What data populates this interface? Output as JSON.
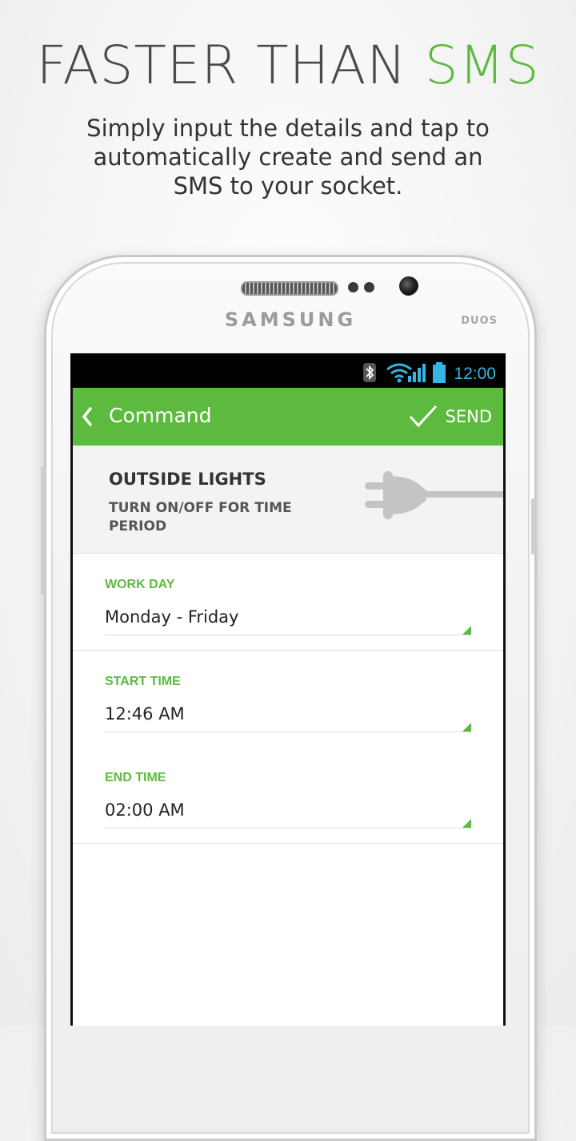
{
  "promo": {
    "headline_main": "FASTER THAN ",
    "headline_accent": "SMS",
    "subtitle": "Simply input the details and tap to automatically create and send an SMS to your socket."
  },
  "phone": {
    "brand": "SAMSUNG",
    "model_badge": "DUOS"
  },
  "status_bar": {
    "time": "12:00",
    "icons": [
      "bluetooth-icon",
      "wifi-icon",
      "signal-icon",
      "battery-icon"
    ]
  },
  "app_bar": {
    "title": "Command",
    "action_label": "SEND",
    "back_icon": "chevron-left-icon",
    "action_icon": "checkmark-icon"
  },
  "device": {
    "name": "OUTSIDE LIGHTS",
    "description": "TURN ON/OFF FOR TIME PERIOD",
    "icon": "plug-icon"
  },
  "fields": [
    {
      "label": "WORK DAY",
      "value": "Monday - Friday"
    },
    {
      "label": "START TIME",
      "value": "12:46 AM"
    },
    {
      "label": "END TIME",
      "value": "02:00 AM"
    }
  ],
  "colors": {
    "accent": "#5cbb3f",
    "status_icon": "#33b5e5",
    "headline": "#4a4a4a"
  }
}
